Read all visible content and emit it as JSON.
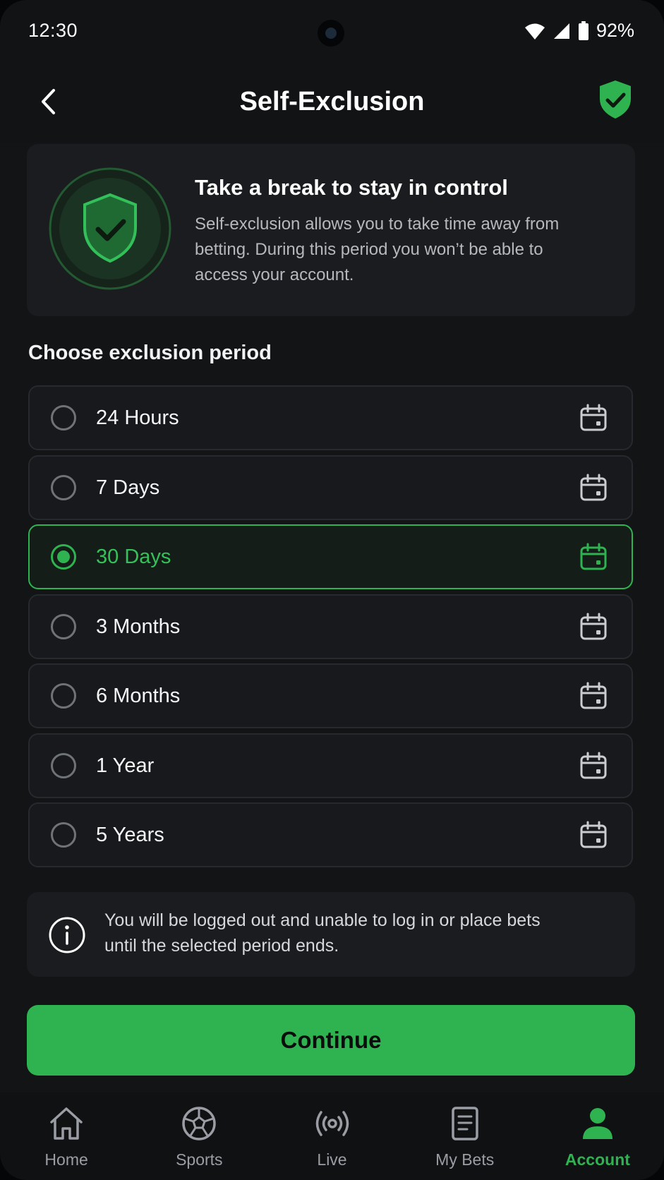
{
  "status_bar": {
    "time": "12:30",
    "battery": "92%"
  },
  "header": {
    "title": "Self-Exclusion"
  },
  "intro": {
    "title": "Take a break to stay in control",
    "text": "Self-exclusion allows you to take time away from betting. During this period you won’t be able to access your account."
  },
  "section": {
    "label": "Choose exclusion period"
  },
  "options": [
    {
      "label": "24 Hours",
      "selected": false
    },
    {
      "label": "7 Days",
      "selected": false
    },
    {
      "label": "30 Days",
      "selected": true
    },
    {
      "label": "3 Months",
      "selected": false
    },
    {
      "label": "6 Months",
      "selected": false
    },
    {
      "label": "1 Year",
      "selected": false
    },
    {
      "label": "5 Years",
      "selected": false
    }
  ],
  "warning": {
    "text": "You will be logged out and unable to log in or place bets until the selected period ends."
  },
  "continue_label": "Continue",
  "nav": {
    "items": [
      {
        "label": "Home",
        "icon": "home-icon"
      },
      {
        "label": "Sports",
        "icon": "soccer-ball-icon"
      },
      {
        "label": "Live",
        "icon": "broadcast-icon"
      },
      {
        "label": "My Bets",
        "icon": "bet-slip-icon"
      },
      {
        "label": "Account",
        "icon": "user-icon"
      }
    ],
    "active_index": 4
  },
  "colors": {
    "accent": "#2fb350",
    "background": "#121416",
    "card": "#1a1c1f"
  }
}
